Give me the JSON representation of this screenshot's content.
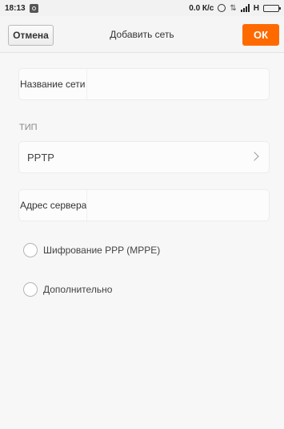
{
  "status_bar": {
    "time": "18:13",
    "speed": "0.0 К/с",
    "network": "H",
    "icons": [
      "notification-icon",
      "alarm-icon",
      "data-arrows-icon",
      "signal-icon",
      "battery-icon"
    ]
  },
  "header": {
    "cancel_label": "Отмена",
    "title": "Добавить сеть",
    "ok_label": "ОК",
    "accent_color": "#ff6a00"
  },
  "form": {
    "network_name_label": "Название сети",
    "network_name_value": "",
    "type_section_label": "ТИП",
    "type_value": "PPTP",
    "server_address_label": "Адрес сервера",
    "server_address_value": "",
    "mppe_label": "Шифрование PPP (MPPE)",
    "mppe_checked": false,
    "advanced_label": "Дополнительно",
    "advanced_checked": false
  }
}
